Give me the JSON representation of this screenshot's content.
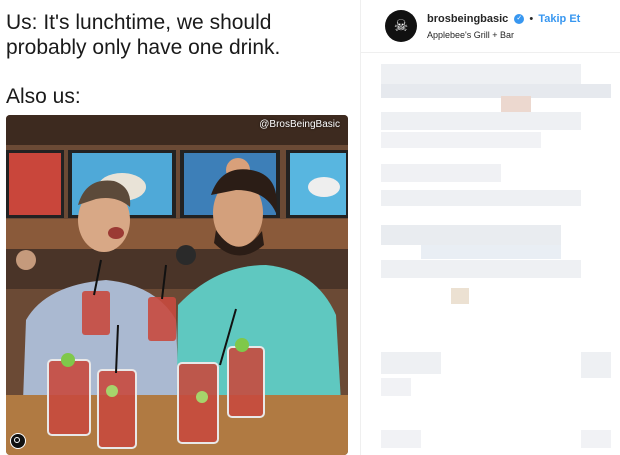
{
  "caption": {
    "line1": "Us: It's lunchtime, we should probably only have one drink.",
    "line2": "Also us:"
  },
  "photo": {
    "watermark": "@BrosBeingBasic"
  },
  "instagram": {
    "username": "brosbeingbasic",
    "verified_icon": "check-badge-icon",
    "separator": "•",
    "follow_label": "Takip Et",
    "location": "Applebee's Grill + Bar",
    "avatar_icon": "skull-icon"
  },
  "colors": {
    "link": "#3897f0",
    "text": "#262626"
  }
}
